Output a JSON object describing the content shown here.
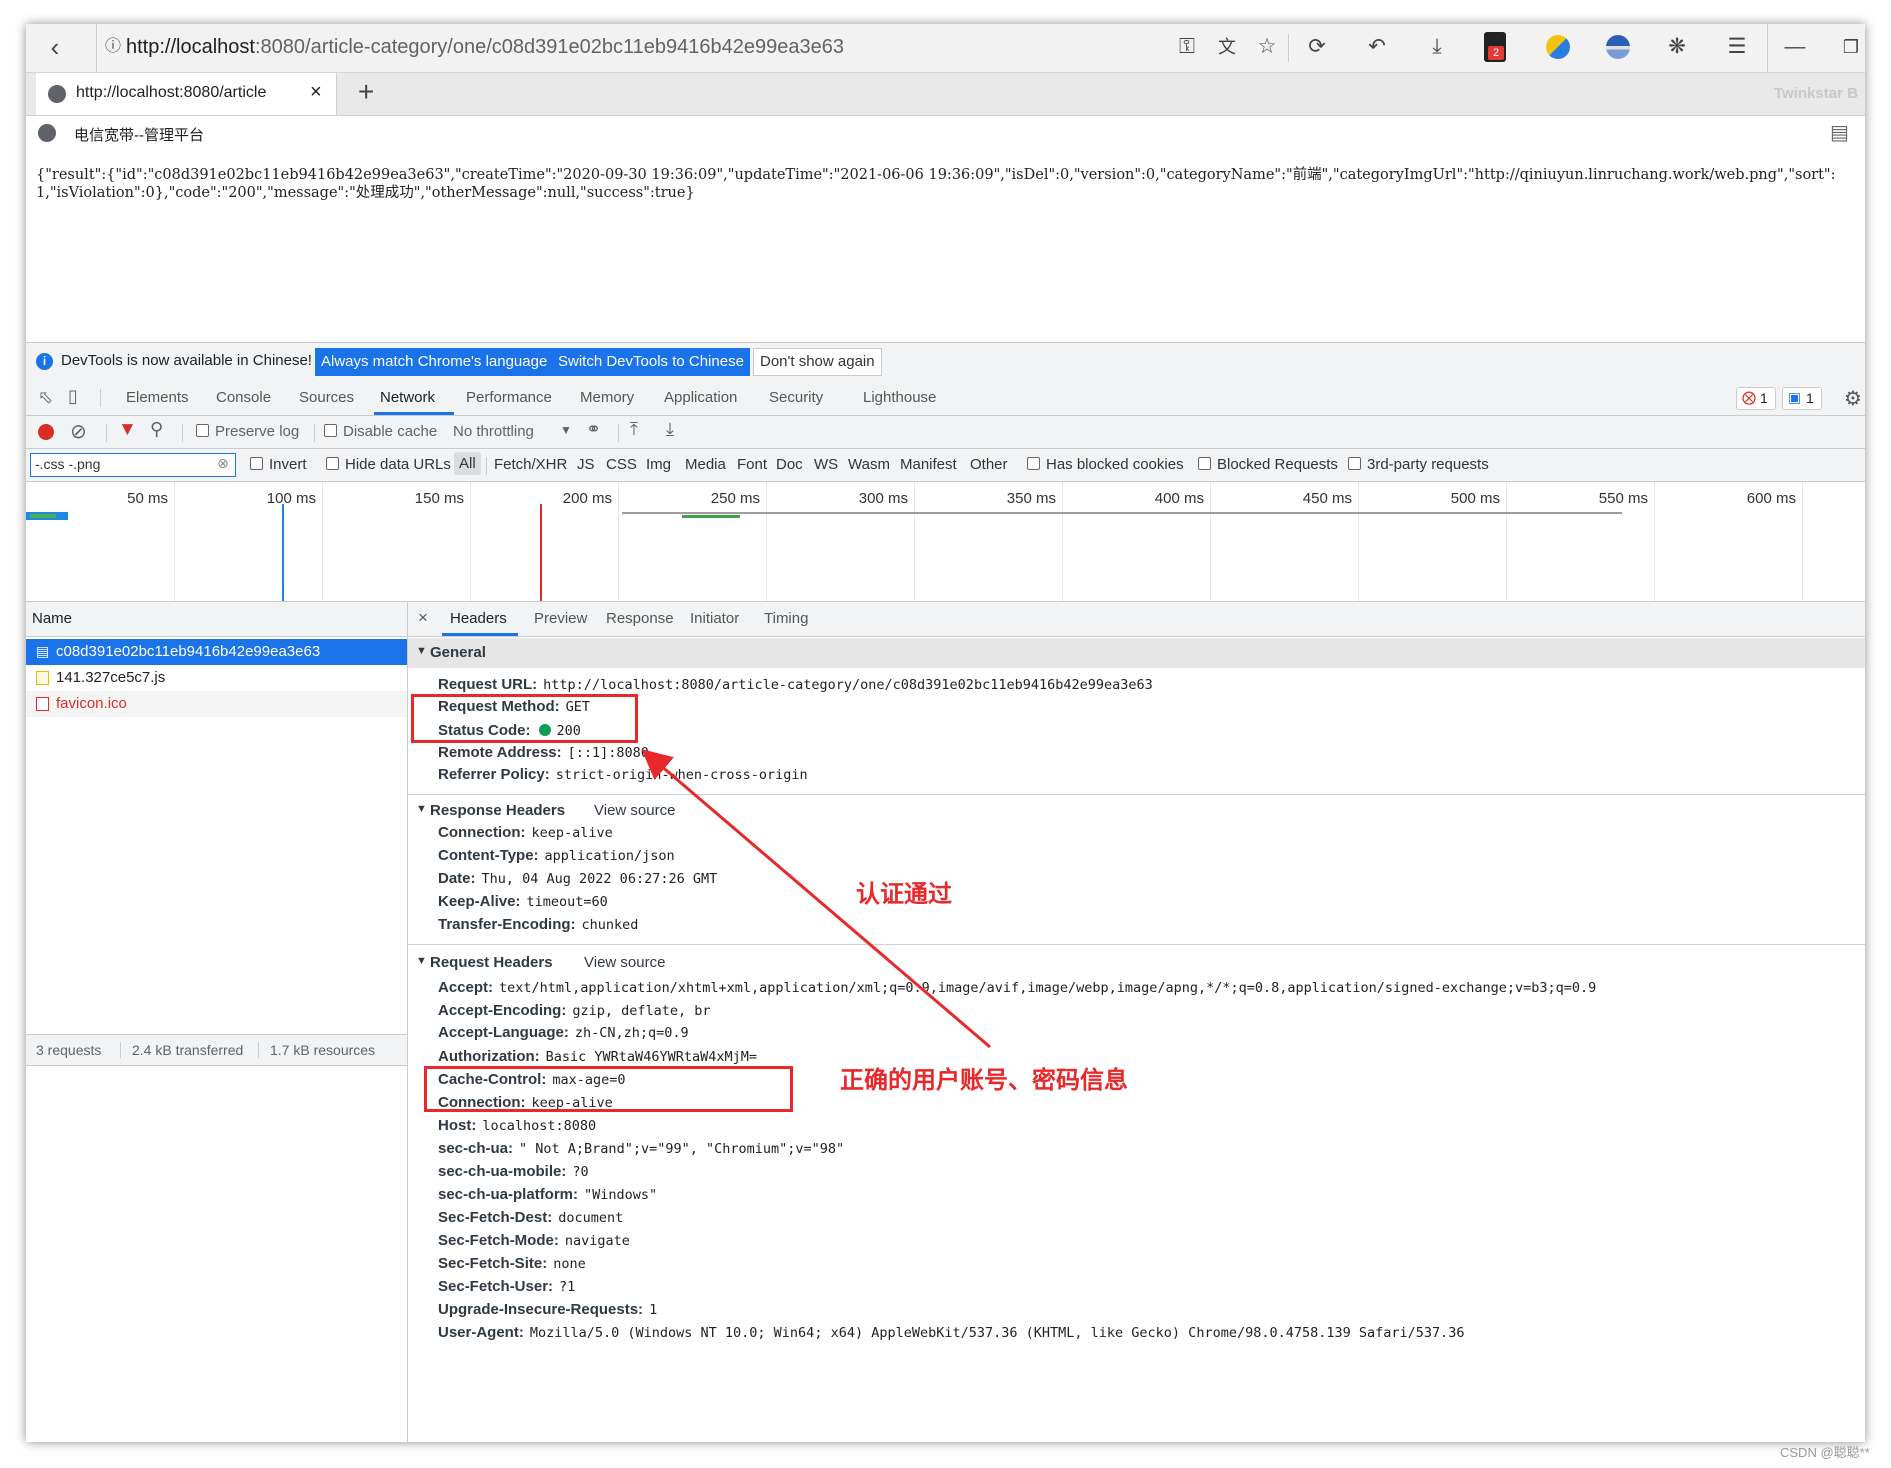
{
  "browser": {
    "url_host": "http://localhost",
    "url_rest": ":8080/article-category/one/c08d391e02bc11eb9416b42e99ea3e63",
    "tab_title": "http://localhost:8080/article",
    "profile_name": "Twinkstar B",
    "bookmark_label": "电信宽带--管理平台",
    "badge_count": "2"
  },
  "page": {
    "json_text": "{\"result\":{\"id\":\"c08d391e02bc11eb9416b42e99ea3e63\",\"createTime\":\"2020-09-30 19:36:09\",\"updateTime\":\"2021-06-06 19:36:09\",\"isDel\":0,\"version\":0,\"categoryName\":\"前端\",\"categoryImgUrl\":\"http://qiniuyun.linruchang.work/web.png\",\"sort\":1,\"isViolation\":0},\"code\":\"200\",\"message\":\"处理成功\",\"otherMessage\":null,\"success\":true}"
  },
  "devtools": {
    "infobar": {
      "message": "DevTools is now available in Chinese!",
      "btn_match": "Always match Chrome's language",
      "btn_switch": "Switch DevTools to Chinese",
      "btn_dismiss": "Don't show again"
    },
    "tabs": [
      "Elements",
      "Console",
      "Sources",
      "Network",
      "Performance",
      "Memory",
      "Application",
      "Security",
      "Lighthouse"
    ],
    "active_tab": "Network",
    "errors_count": "1",
    "messages_count": "1",
    "toolbar": {
      "preserve_log": "Preserve log",
      "disable_cache": "Disable cache",
      "throttling": "No throttling"
    },
    "filter": {
      "value": "-.css  -.png",
      "invert": "Invert",
      "hide_data_urls": "Hide data URLs",
      "types": [
        "All",
        "Fetch/XHR",
        "JS",
        "CSS",
        "Img",
        "Media",
        "Font",
        "Doc",
        "WS",
        "Wasm",
        "Manifest",
        "Other"
      ],
      "blocked_cookies": "Has blocked cookies",
      "blocked_requests": "Blocked Requests",
      "third_party": "3rd-party requests"
    },
    "timeline_ticks": [
      "50 ms",
      "100 ms",
      "150 ms",
      "200 ms",
      "250 ms",
      "300 ms",
      "350 ms",
      "400 ms",
      "450 ms",
      "500 ms",
      "550 ms",
      "600 ms"
    ],
    "requests": {
      "header": "Name",
      "items": [
        "c08d391e02bc11eb9416b42e99ea3e63",
        "141.327ce5c7.js",
        "favicon.ico"
      ],
      "status": [
        "3 requests",
        "2.4 kB transferred",
        "1.7 kB resources"
      ]
    },
    "detail_tabs": [
      "Headers",
      "Preview",
      "Response",
      "Initiator",
      "Timing"
    ],
    "general": {
      "title": "General",
      "rows": [
        {
          "k": "Request URL:",
          "v": "http://localhost:8080/article-category/one/c08d391e02bc11eb9416b42e99ea3e63"
        },
        {
          "k": "Request Method:",
          "v": "GET"
        },
        {
          "k": "Status Code:",
          "v": "200"
        },
        {
          "k": "Remote Address:",
          "v": "[::1]:8080"
        },
        {
          "k": "Referrer Policy:",
          "v": "strict-origin-when-cross-origin"
        }
      ]
    },
    "response_headers": {
      "title": "Response Headers",
      "view_source": "View source",
      "rows": [
        {
          "k": "Connection:",
          "v": "keep-alive"
        },
        {
          "k": "Content-Type:",
          "v": "application/json"
        },
        {
          "k": "Date:",
          "v": "Thu, 04 Aug 2022 06:27:26 GMT"
        },
        {
          "k": "Keep-Alive:",
          "v": "timeout=60"
        },
        {
          "k": "Transfer-Encoding:",
          "v": "chunked"
        }
      ]
    },
    "request_headers": {
      "title": "Request Headers",
      "view_source": "View source",
      "rows": [
        {
          "k": "Accept:",
          "v": "text/html,application/xhtml+xml,application/xml;q=0.9,image/avif,image/webp,image/apng,*/*;q=0.8,application/signed-exchange;v=b3;q=0.9"
        },
        {
          "k": "Accept-Encoding:",
          "v": "gzip, deflate, br"
        },
        {
          "k": "Accept-Language:",
          "v": "zh-CN,zh;q=0.9"
        },
        {
          "k": "Authorization:",
          "v": "Basic YWRtaW46YWRtaW4xMjM="
        },
        {
          "k": "Cache-Control:",
          "v": "max-age=0"
        },
        {
          "k": "Connection:",
          "v": "keep-alive"
        },
        {
          "k": "Host:",
          "v": "localhost:8080"
        },
        {
          "k": "sec-ch-ua:",
          "v": "\" Not A;Brand\";v=\"99\", \"Chromium\";v=\"98\""
        },
        {
          "k": "sec-ch-ua-mobile:",
          "v": "?0"
        },
        {
          "k": "sec-ch-ua-platform:",
          "v": "\"Windows\""
        },
        {
          "k": "Sec-Fetch-Dest:",
          "v": "document"
        },
        {
          "k": "Sec-Fetch-Mode:",
          "v": "navigate"
        },
        {
          "k": "Sec-Fetch-Site:",
          "v": "none"
        },
        {
          "k": "Sec-Fetch-User:",
          "v": "?1"
        },
        {
          "k": "Upgrade-Insecure-Requests:",
          "v": "1"
        },
        {
          "k": "User-Agent:",
          "v": "Mozilla/5.0 (Windows NT 10.0; Win64; x64) AppleWebKit/537.36 (KHTML, like Gecko) Chrome/98.0.4758.139 Safari/537.36"
        }
      ]
    }
  },
  "annotations": {
    "auth_passed": "认证通过",
    "correct_credentials": "正确的用户账号、密码信息",
    "color": "#e8282b"
  },
  "watermark": "CSDN @聪聪**"
}
